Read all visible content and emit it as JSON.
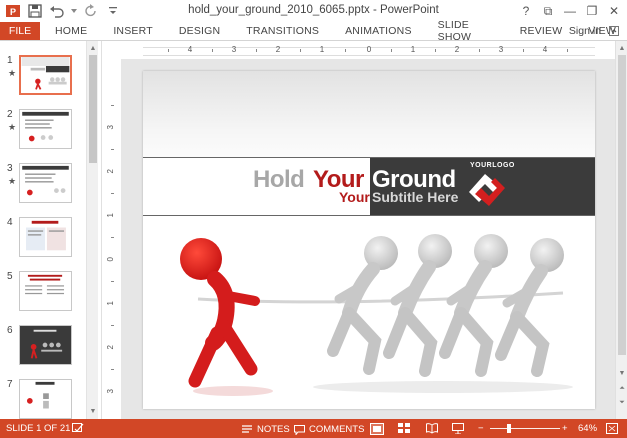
{
  "window": {
    "title": "hold_your_ground_2010_6065.pptx - PowerPoint",
    "controls": [
      "?",
      "⧉",
      "—",
      "❐",
      "✕"
    ]
  },
  "quick_access": {
    "icons": [
      "powerpoint-logo-icon",
      "save-icon",
      "undo-icon",
      "redo-icon",
      "customize-icon"
    ]
  },
  "ribbon": {
    "file_label": "FILE",
    "tabs": [
      "HOME",
      "INSERT",
      "DESIGN",
      "TRANSITIONS",
      "ANIMATIONS",
      "SLIDE SHOW",
      "REVIEW",
      "VIEW"
    ],
    "signin": "Sign in"
  },
  "colors": {
    "accent": "#d24726",
    "title_red": "#b31b1b",
    "banner_dark": "#3b3b3b"
  },
  "thumbnails": [
    {
      "num": "1",
      "star": "★",
      "selected": true
    },
    {
      "num": "2",
      "star": "★",
      "selected": false
    },
    {
      "num": "3",
      "star": "★",
      "selected": false
    },
    {
      "num": "4",
      "star": "",
      "selected": false
    },
    {
      "num": "5",
      "star": "",
      "selected": false
    },
    {
      "num": "6",
      "star": "",
      "selected": false
    },
    {
      "num": "7",
      "star": "",
      "selected": false
    }
  ],
  "ruler": {
    "horizontal": [
      "4",
      "3",
      "2",
      "1",
      "0",
      "1",
      "2",
      "3",
      "4"
    ],
    "vertical": [
      "3",
      "2",
      "1",
      "0",
      "1",
      "2",
      "3"
    ]
  },
  "slide": {
    "title_part1": "Hold",
    "title_part2": "Your",
    "title_part3": "Ground",
    "subtitle_part1": "Your",
    "subtitle_part2": "Subtitle Here",
    "logo_text": "YOURLOGO"
  },
  "status": {
    "slide_info": "SLIDE 1 OF 21",
    "notes": "NOTES",
    "comments": "COMMENTS",
    "zoom": "64%",
    "zoom_minus": "−",
    "zoom_plus": "+"
  }
}
